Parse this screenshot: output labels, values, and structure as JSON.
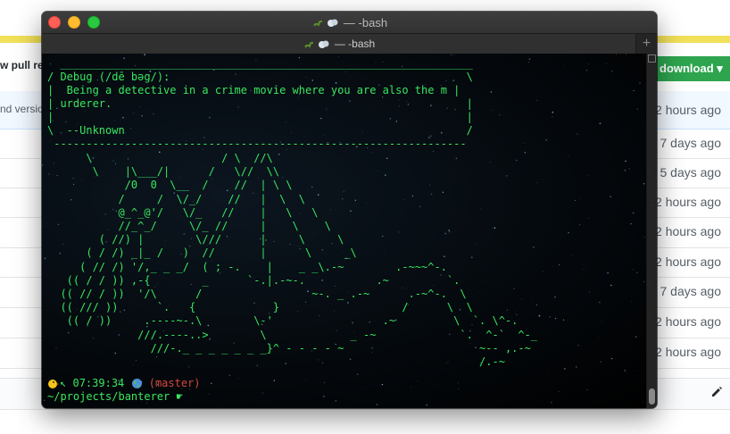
{
  "background_page": {
    "pull_request_label": "w pull re",
    "download_label": "download ▾",
    "version_text": "nd versio",
    "row_times": [
      "2 hours ago",
      "7 days ago",
      "5 days ago",
      "2 hours ago",
      "2 hours ago",
      "2 hours ago",
      "7 days ago",
      "2 hours ago",
      "2 hours ago"
    ]
  },
  "terminal": {
    "window_title": "— -bash",
    "tab_title": "— -bash",
    "add_tab_label": "+",
    "cowsay_text": "  ________________________________________________________________\n/ Debug (/dē bəg/):                                              \\\n|  Being a detective in a crime movie where you are also the m |\n| urderer.                                                       |\n|                                                                |\n\\  --Unknown                                                     /\n ----------------------------------------------------------------",
    "ascii_art": "      \\                    / \\  //\\\n       \\    |\\___/|      /   \\//  \\\\\n            /0  0  \\__  /    //  | \\ \\\n           /     /  \\/_/    //   |  \\  \\\n           @_^_@'/   \\/_   //    |   \\   \\\n           //_^_/     \\/_ //     |    \\    \\\n        ( //) |        \\///      |     \\     \\\n      ( / /) _|_ /   )  //       |      \\     _\\\n     ( // /) '/,_ _ _/  ( ; -.    |    _ _\\.-~        .-~~~^-.\n   (( / / )) ,-{        _      `-.|.-~-.           .~         `.\n  (( // / ))  '/\\      /                 ~-. _ .-~      .-~^-.  \\\n  (( /// ))      `.   {            }                   /      \\  \\\n   (( / ))     .----~-.\\        \\-'                 .~         \\  `. \\^-.\n              ///.----..>        \\             _ -~             `.  ^-`  ^-_\n                ///-._ _ _ _ _ _ _}^ - - - - ~                     ~-- ,.-~\n                                                                   /.-~",
    "prompt_time": "07:39:34",
    "prompt_branch": "(master)",
    "prompt_path": "~/projects/banterer",
    "prompt_symbol": "☛"
  },
  "colors": {
    "terminal_green": "#39e75f",
    "branch_red": "#d8473d",
    "download_green": "#2ea44f"
  },
  "icons": [
    "dinosaur-icon",
    "puff-icon",
    "chick-icon",
    "globe-icon",
    "pencil-icon"
  ]
}
